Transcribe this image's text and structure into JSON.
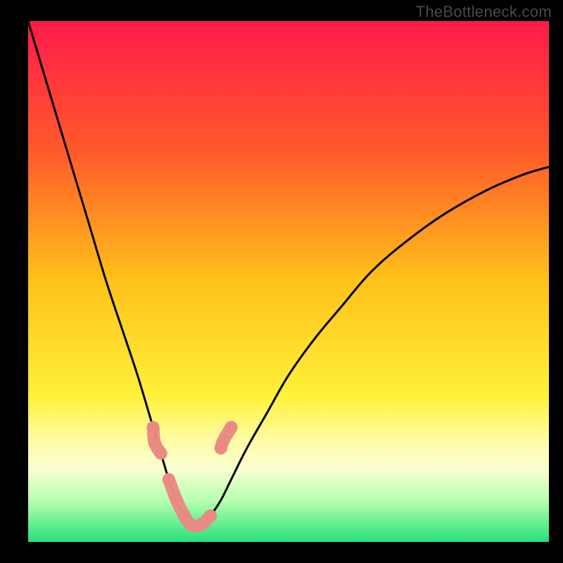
{
  "watermark": "TheBottleneck.com",
  "chart_data": {
    "type": "line",
    "title": "",
    "xlabel": "",
    "ylabel": "",
    "xlim": [
      0,
      100
    ],
    "ylim": [
      0,
      100
    ],
    "gradient_stops": [
      {
        "offset": 0,
        "color": "#ff1a4b"
      },
      {
        "offset": 25,
        "color": "#ff5a2a"
      },
      {
        "offset": 50,
        "color": "#ffc21a"
      },
      {
        "offset": 72,
        "color": "#fff13a"
      },
      {
        "offset": 80,
        "color": "#fffba0"
      },
      {
        "offset": 86,
        "color": "#f8ffd0"
      },
      {
        "offset": 92,
        "color": "#b8ffb0"
      },
      {
        "offset": 100,
        "color": "#25e17a"
      }
    ],
    "series": [
      {
        "name": "bottleneck-curve",
        "type": "line",
        "color": "#000000",
        "x": [
          0.0,
          3.0,
          6.0,
          9.0,
          12.0,
          15.0,
          18.0,
          21.0,
          24.0,
          25.5,
          27.0,
          28.5,
          30.0,
          31.0,
          32.0,
          33.5,
          35.0,
          37.0,
          39.0,
          42.0,
          46.0,
          50.0,
          55.0,
          60.0,
          66.0,
          73.0,
          80.0,
          88.0,
          95.0,
          100.0
        ],
        "y": [
          100.0,
          90.0,
          80.0,
          70.0,
          60.0,
          50.0,
          41.0,
          32.0,
          22.0,
          17.0,
          12.0,
          8.0,
          5.0,
          3.5,
          3.0,
          3.5,
          5.0,
          8.0,
          12.0,
          18.0,
          25.0,
          32.0,
          39.0,
          45.0,
          52.0,
          58.0,
          63.0,
          67.5,
          70.5,
          72.0
        ]
      },
      {
        "name": "highlight-left",
        "type": "scatter",
        "color": "#e98a83",
        "x": [
          24.0,
          24.3,
          25.5
        ],
        "y": [
          22.0,
          19.0,
          17.0
        ]
      },
      {
        "name": "highlight-bottom",
        "type": "scatter",
        "color": "#e98a83",
        "x": [
          27.0,
          28.5,
          30.0,
          31.0,
          32.0,
          33.5,
          35.0
        ],
        "y": [
          12.0,
          8.0,
          5.0,
          3.5,
          3.0,
          3.5,
          5.0
        ]
      },
      {
        "name": "highlight-right",
        "type": "scatter",
        "color": "#e98a83",
        "x": [
          37.0,
          37.5,
          39.0
        ],
        "y": [
          18.0,
          19.5,
          22.0
        ]
      }
    ]
  }
}
